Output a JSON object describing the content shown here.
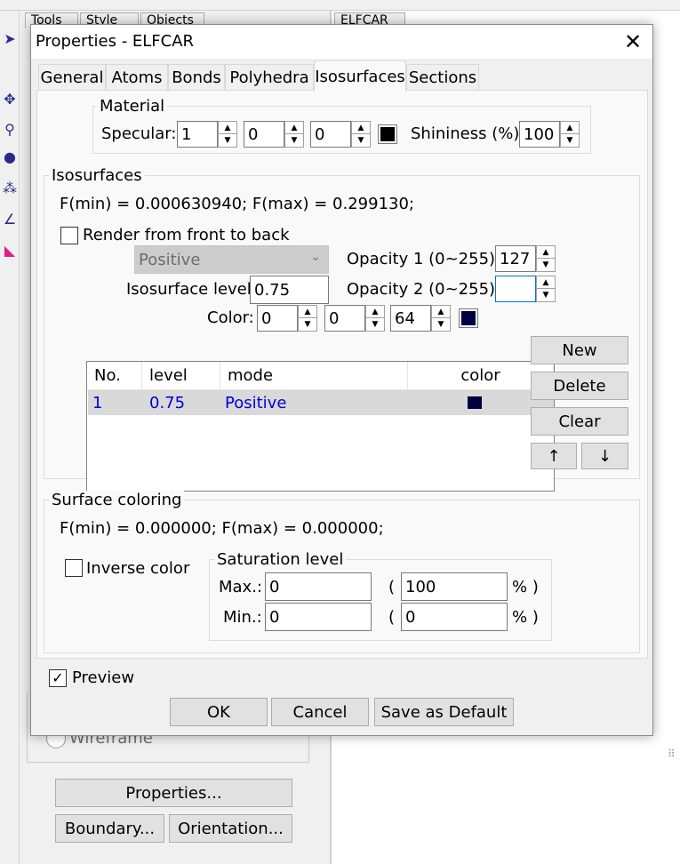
{
  "background": {
    "bg_tabs": [
      "Tools",
      "Style",
      "Objects",
      "ELFCAR"
    ],
    "wireframe_label": "Wireframe",
    "properties_button": "Properties...",
    "boundary_button": "Boundary...",
    "orientation_button": "Orientation..."
  },
  "dialog": {
    "title": "Properties - ELFCAR",
    "close": "✕",
    "tabs": [
      "General",
      "Atoms",
      "Bonds",
      "Polyhedra",
      "Isosurfaces",
      "Sections"
    ],
    "active_tab": "Isosurfaces"
  },
  "material": {
    "group_label": "Material",
    "specular_label": "Specular:",
    "specular_values": [
      "1",
      "0",
      "0"
    ],
    "specular_color": "#000000",
    "shininess_label": "Shininess (%):",
    "shininess_value": "100"
  },
  "isosurfaces": {
    "group_label": "Isosurfaces",
    "f_range": "F(min) = 0.000630940;   F(max) = 0.299130;",
    "render_front_label": "Render from front to back",
    "mode_value": "Positive",
    "opacity1_label": "Opacity 1 (0~255):",
    "opacity1_value": "127",
    "level_label": "Isosurface level:",
    "level_value": "0.75",
    "opacity2_label": "Opacity 2 (0~255):",
    "opacity2_value": "",
    "color_label": "Color:",
    "color_values": [
      "0",
      "0",
      "64"
    ],
    "color_swatch": "#000040",
    "table": {
      "headers": [
        "No.",
        "level",
        "mode",
        "color"
      ],
      "rows": [
        {
          "no": "1",
          "level": "0.75",
          "mode": "Positive",
          "color": "#000040"
        }
      ]
    },
    "new_button": "New",
    "delete_button": "Delete",
    "clear_button": "Clear",
    "up_button": "↑",
    "down_button": "↓"
  },
  "surface_coloring": {
    "group_label": "Surface coloring",
    "f_range": "F(min) = 0.000000;   F(max) = 0.000000;",
    "inverse_label": "Inverse color",
    "saturation_label": "Saturation level",
    "max_label": "Max.:",
    "max_value": "0",
    "max_pct": "100",
    "min_label": "Min.:",
    "min_value": "0",
    "min_pct": "0",
    "open_paren": "(",
    "pct_close": "% )"
  },
  "footer": {
    "preview_label": "Preview",
    "preview_checked": "✓",
    "ok": "OK",
    "cancel": "Cancel",
    "save_default": "Save as Default"
  }
}
